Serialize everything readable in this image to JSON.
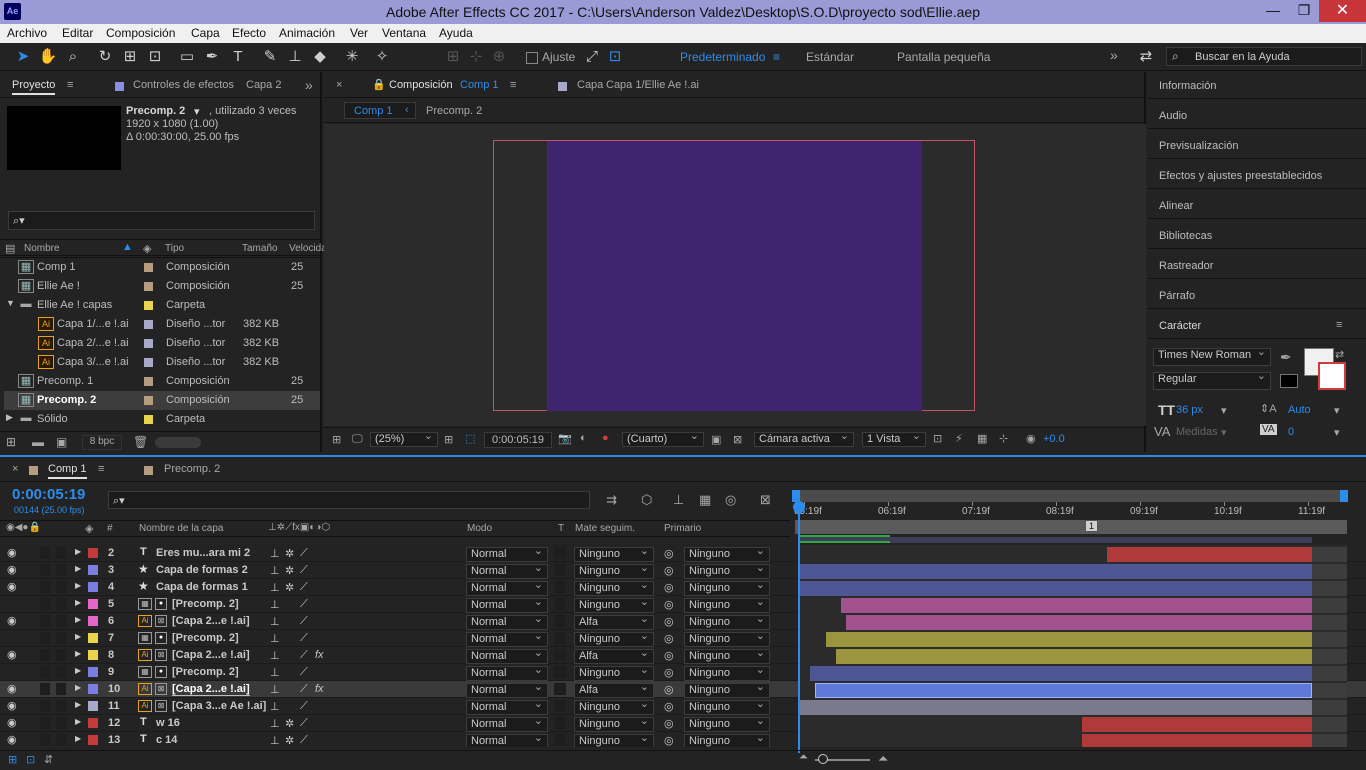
{
  "app": {
    "logo": "Ae",
    "title": "Adobe After Effects CC 2017 - C:\\Users\\Anderson Valdez\\Desktop\\S.O.D\\proyecto sod\\Ellie.aep",
    "min": "—",
    "restore": "❐",
    "close": "✕"
  },
  "menu": [
    "Archivo",
    "Editar",
    "Composición",
    "Capa",
    "Efecto",
    "Animación",
    "Ver",
    "Ventana",
    "Ayuda"
  ],
  "toolbar": {
    "snap_label": "Ajuste",
    "workspaces": [
      "Predeterminado",
      "Estándar",
      "Pantalla pequeña"
    ],
    "more": "»",
    "search_placeholder": "Buscar en la Ayuda"
  },
  "project": {
    "tab": "Proyecto",
    "tab2": "Controles de efectos",
    "tab2_sub": "Capa 2",
    "preview_name": "Precomp. 2",
    "preview_used": ", utilizado 3 veces",
    "preview_size": "1920 x 1080 (1.00)",
    "preview_duration": "Δ 0:00:30:00, 25.00 fps",
    "search_icon": "⌕▾",
    "columns": [
      "Nombre",
      "Tipo",
      "Tamaño",
      "Velocida"
    ],
    "rows": [
      {
        "name": "Comp 1",
        "type": "Composición",
        "size": "",
        "speed": "25",
        "color": "#b79d80",
        "icon": "comp",
        "indent": 0
      },
      {
        "name": "Ellie Ae !",
        "type": "Composición",
        "size": "",
        "speed": "25",
        "color": "#b79d80",
        "icon": "comp",
        "indent": 0
      },
      {
        "name": "Ellie Ae ! capas",
        "type": "Carpeta",
        "size": "",
        "speed": "",
        "color": "#e8d44d",
        "icon": "folder",
        "indent": 0
      },
      {
        "name": "Capa 1/...e !.ai",
        "type": "Diseño ...tor",
        "size": "382 KB",
        "speed": "",
        "color": "#a8a8c8",
        "icon": "ai",
        "indent": 1
      },
      {
        "name": "Capa 2/...e !.ai",
        "type": "Diseño ...tor",
        "size": "382 KB",
        "speed": "",
        "color": "#a8a8c8",
        "icon": "ai",
        "indent": 1
      },
      {
        "name": "Capa 3/...e !.ai",
        "type": "Diseño ...tor",
        "size": "382 KB",
        "speed": "",
        "color": "#a8a8c8",
        "icon": "ai",
        "indent": 1
      },
      {
        "name": "Precomp. 1",
        "type": "Composición",
        "size": "",
        "speed": "25",
        "color": "#b79d80",
        "icon": "comp",
        "indent": 0
      },
      {
        "name": "Precomp. 2",
        "type": "Composición",
        "size": "",
        "speed": "25",
        "color": "#b79d80",
        "icon": "comp",
        "indent": 0,
        "selected": true
      },
      {
        "name": "Sólido",
        "type": "Carpeta",
        "size": "",
        "speed": "",
        "color": "#e8d44d",
        "icon": "folder",
        "indent": 0
      }
    ],
    "bpc": "8 bpc"
  },
  "comp": {
    "tab_prefix": "Composición",
    "tab_name": "Comp 1",
    "layer_tab": "Capa",
    "layer_tab_name": "Capa 1/Ellie Ae !.ai",
    "crumb1": "Comp 1",
    "crumb2": "Precomp. 2",
    "zoom": "(25%)",
    "time": "0:00:05:19",
    "res": "(Cuarto)",
    "camera": "Cámara activa",
    "views": "1 Vista",
    "exposure": "+0.0",
    "canvas_color": "#3f2470"
  },
  "right": {
    "items": [
      "Información",
      "Audio",
      "Previsualización",
      "Efectos y ajustes preestablecidos",
      "Alinear",
      "Bibliotecas",
      "Rastreador",
      "Párrafo",
      "Carácter"
    ],
    "font": "Times New Roman",
    "style": "Regular",
    "size": "36 px",
    "leading": "Auto",
    "tracking_label": "Medidas",
    "tracking": "0"
  },
  "timeline": {
    "tab": "Comp 1",
    "tab2": "Precomp. 2",
    "time": "0:00:05:19",
    "frames": "00144 (25.00 fps)",
    "search_placeholder": "⌕▾",
    "cols": {
      "num": "#",
      "name": "Nombre de la capa",
      "mode": "Modo",
      "t": "T",
      "matte": "Mate seguim.",
      "parent": "Primario"
    },
    "ruler": [
      "05:19f",
      "06:19f",
      "07:19f",
      "08:19f",
      "09:19f",
      "10:19f",
      "11:19f"
    ],
    "marker": "1",
    "layers": [
      {
        "n": "2",
        "type": "T",
        "name": "Eres mu...ara mi 2",
        "mode": "Normal",
        "matte": "Ninguno",
        "parent": "Ninguno",
        "color": "#c23a3a",
        "bar": "#b03a3a",
        "bs": 0.6,
        "eye": true,
        "fx": false,
        "bold": true
      },
      {
        "n": "3",
        "type": "★",
        "name": "Capa de formas 2",
        "mode": "Normal",
        "matte": "Ninguno",
        "parent": "Ninguno",
        "color": "#7a7ee0",
        "bar": "#4f5694",
        "bs": 0.0,
        "eye": true,
        "fx": false,
        "bold": true
      },
      {
        "n": "4",
        "type": "★",
        "name": "Capa de formas 1",
        "mode": "Normal",
        "matte": "Ninguno",
        "parent": "Ninguno",
        "color": "#7a7ee0",
        "bar": "#4f5694",
        "bs": 0.0,
        "eye": true,
        "fx": false,
        "bold": true
      },
      {
        "n": "5",
        "type": "comp",
        "name": "[Precomp. 2]",
        "mode": "Normal",
        "matte": "Ninguno",
        "parent": "Ninguno",
        "color": "#e465c8",
        "bar": "#a1528f",
        "bs": 0.08,
        "eye": false,
        "fx": false,
        "bold": true
      },
      {
        "n": "6",
        "type": "ai",
        "name": "[Capa 2...e !.ai]",
        "mode": "Normal",
        "matte": "Alfa",
        "parent": "Ninguno",
        "color": "#e465c8",
        "bar": "#a1528f",
        "bs": 0.09,
        "eye": true,
        "fx": false,
        "bold": true
      },
      {
        "n": "7",
        "type": "comp",
        "name": "[Precomp. 2]",
        "mode": "Normal",
        "matte": "Ninguno",
        "parent": "Ninguno",
        "color": "#e8d44d",
        "bar": "#9b9540",
        "bs": 0.05,
        "eye": false,
        "fx": false,
        "bold": true
      },
      {
        "n": "8",
        "type": "ai",
        "name": "[Capa 2...e !.ai]",
        "mode": "Normal",
        "matte": "Alfa",
        "parent": "Ninguno",
        "color": "#e8d44d",
        "bar": "#9b9540",
        "bs": 0.07,
        "eye": true,
        "fx": true,
        "bold": true
      },
      {
        "n": "9",
        "type": "comp",
        "name": "[Precomp. 2]",
        "mode": "Normal",
        "matte": "Ninguno",
        "parent": "Ninguno",
        "color": "#7a7ee0",
        "bar": "#4f5694",
        "bs": 0.02,
        "eye": false,
        "fx": false,
        "bold": true
      },
      {
        "n": "10",
        "type": "ai",
        "name": "[Capa 2...e !.ai]",
        "mode": "Normal",
        "matte": "Alfa",
        "parent": "Ninguno",
        "color": "#7a7ee0",
        "bar": "#5f79d9",
        "bs": 0.03,
        "eye": true,
        "fx": true,
        "bold": true,
        "selected": true
      },
      {
        "n": "11",
        "type": "ai",
        "name": "[Capa 3...e Ae !.ai]",
        "mode": "Normal",
        "matte": "Ninguno",
        "parent": "Ninguno",
        "color": "#a8a8c8",
        "bar": "#7a7a8c",
        "bs": 0.0,
        "eye": true,
        "fx": false,
        "bold": true
      },
      {
        "n": "12",
        "type": "T",
        "name": "w 16",
        "mode": "Normal",
        "matte": "Ninguno",
        "parent": "Ninguno",
        "color": "#c23a3a",
        "bar": "#b03a3a",
        "bs": 0.55,
        "eye": true,
        "fx": false,
        "bold": true
      },
      {
        "n": "13",
        "type": "T",
        "name": "c 14",
        "mode": "Normal",
        "matte": "Ninguno",
        "parent": "Ninguno",
        "color": "#c23a3a",
        "bar": "#b03a3a",
        "bs": 0.55,
        "eye": true,
        "fx": false,
        "bold": true
      }
    ]
  }
}
